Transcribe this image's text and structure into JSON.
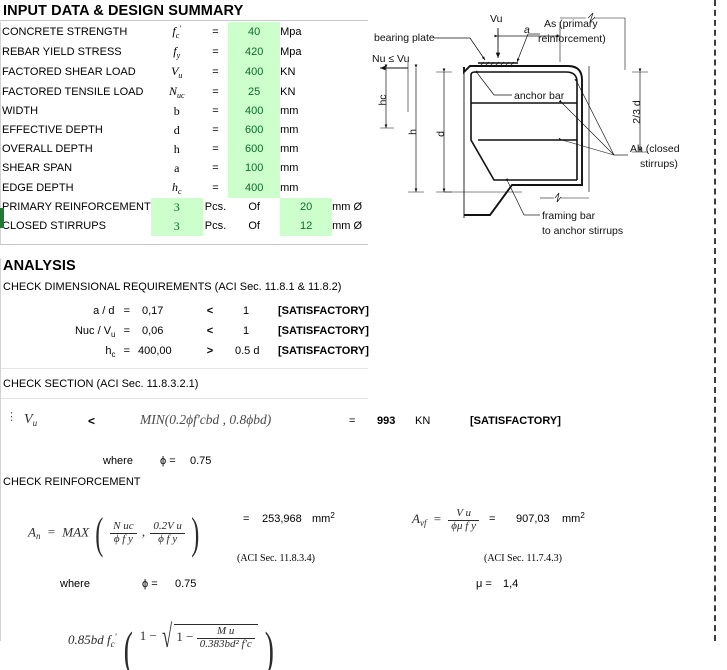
{
  "sections": {
    "input_title": "INPUT DATA & DESIGN SUMMARY",
    "analysis_title": "ANALYSIS",
    "check_dimensional": "CHECK DIMENSIONAL REQUIREMENTS (ACI Sec. 11.8.1 & 11.8.2)",
    "check_section": "CHECK SECTION (ACI Sec. 11.8.3.2.1)",
    "check_reinforcement": "CHECK REINFORCEMENT"
  },
  "input_rows": [
    {
      "label": "CONCRETE STRENGTH",
      "sym": "f",
      "sub": "c",
      "sup": "'",
      "eq": "=",
      "value": "40",
      "unit": "Mpa"
    },
    {
      "label": "REBAR YIELD STRESS",
      "sym": "f",
      "sub": "y",
      "sup": "",
      "eq": "=",
      "value": "420",
      "unit": "Mpa"
    },
    {
      "label": "FACTORED SHEAR LOAD",
      "sym": "V",
      "sub": "u",
      "sup": "",
      "eq": "=",
      "value": "400",
      "unit": "KN"
    },
    {
      "label": "FACTORED TENSILE LOAD",
      "sym": "N",
      "sub": "uc",
      "sup": "",
      "eq": "=",
      "value": "25",
      "unit": "KN"
    },
    {
      "label": "WIDTH",
      "sym": "b",
      "sub": "",
      "sup": "",
      "eq": "=",
      "value": "400",
      "unit": "mm"
    },
    {
      "label": "EFFECTIVE DEPTH",
      "sym": "d",
      "sub": "",
      "sup": "",
      "eq": "=",
      "value": "600",
      "unit": "mm"
    },
    {
      "label": "OVERALL DEPTH",
      "sym": "h",
      "sub": "",
      "sup": "",
      "eq": "=",
      "value": "600",
      "unit": "mm"
    },
    {
      "label": "SHEAR SPAN",
      "sym": "a",
      "sub": "",
      "sup": "",
      "eq": "=",
      "value": "100",
      "unit": "mm"
    },
    {
      "label": "EDGE DEPTH",
      "sym": "h",
      "sub": "c",
      "sup": "",
      "eq": "=",
      "value": "400",
      "unit": "mm"
    }
  ],
  "bar_rows": [
    {
      "label": "PRIMARY REINFORCEMENT",
      "count": "3",
      "pcs": "Pcs.",
      "of": "Of",
      "size": "20",
      "unit": "mm Ø"
    },
    {
      "label": "CLOSED STIRRUPS",
      "count": "3",
      "pcs": "Pcs.",
      "of": "Of",
      "size": "12",
      "unit": "mm Ø"
    }
  ],
  "dimensional_checks": [
    {
      "name": "a / d",
      "eq": "=",
      "value": "0,17",
      "op": "<",
      "limit": "1",
      "result": "[SATISFACTORY]"
    },
    {
      "name": "Nuc / V",
      "name_sub": "u",
      "eq": "=",
      "value": "0,06",
      "op": "<",
      "limit": "1",
      "result": "[SATISFACTORY]"
    },
    {
      "name": "h",
      "name_sub": "c",
      "eq": "=",
      "value": "400,00",
      "op": ">",
      "limit": "0.5 d",
      "result": "[SATISFACTORY]"
    }
  ],
  "section_check": {
    "lhs_sym": "V",
    "lhs_sub": "u",
    "op": "<",
    "formula": "MIN(0.2ϕf'cbd , 0.8ϕbd)",
    "eq": "=",
    "value": "993",
    "unit": "KN",
    "result": "[SATISFACTORY]",
    "where": "where",
    "phi_label": "ϕ =",
    "phi_value": "0.75"
  },
  "reinforcement": {
    "an": {
      "sym": "A",
      "sub": "n",
      "func": "MAX",
      "term1_num": "N uc",
      "term1_den": "ϕ f y",
      "term2_num": "0.2V u",
      "term2_den": "ϕ f y",
      "eq": "=",
      "value": "253,968",
      "unit": "mm",
      "unit_sup": "2",
      "ref": "(ACI Sec. 11.8.3.4)",
      "where": "where",
      "phi_label": "ϕ =",
      "phi_value": "0.75"
    },
    "avf": {
      "sym": "A",
      "sub": "vf",
      "num": "V u",
      "den": "ϕμ f y",
      "eq": "=",
      "value": "907,03",
      "unit": "mm",
      "unit_sup": "2",
      "ref": "(ACI Sec. 11.7.4.3)",
      "mu_label": "μ =",
      "mu_value": "1,4"
    },
    "af": {
      "lead": "0.85bd f",
      "lead_sub": "c",
      "one_minus": "1 −",
      "rad_one": "1 −",
      "frac_num": "M u",
      "frac_den": "0.383bd² f'c"
    }
  },
  "diagram": {
    "labels": {
      "bearing_plate": "bearing  plate",
      "vu": "Vu",
      "a": "a",
      "as_line1": "As  (primary",
      "as_line2": "reinforcement)",
      "nu_vu": "Nu ≤ Vu",
      "hc": "hc",
      "h": "h",
      "d": "d",
      "anchor_bar": "anchor  bar",
      "two_thirds_d": "2/3 d",
      "ah_line1": "Ah  (closed",
      "ah_line2": "stirrups)",
      "framing_line1": "framing  bar",
      "framing_line2": "to  anchor  stirrups"
    }
  },
  "colors": {
    "input_cell_bg": "#ccffcc",
    "input_cell_text": "#0b6b26",
    "edge_marker": "#1e7b34",
    "grid": "#d3d3d3",
    "text": "#000000"
  }
}
